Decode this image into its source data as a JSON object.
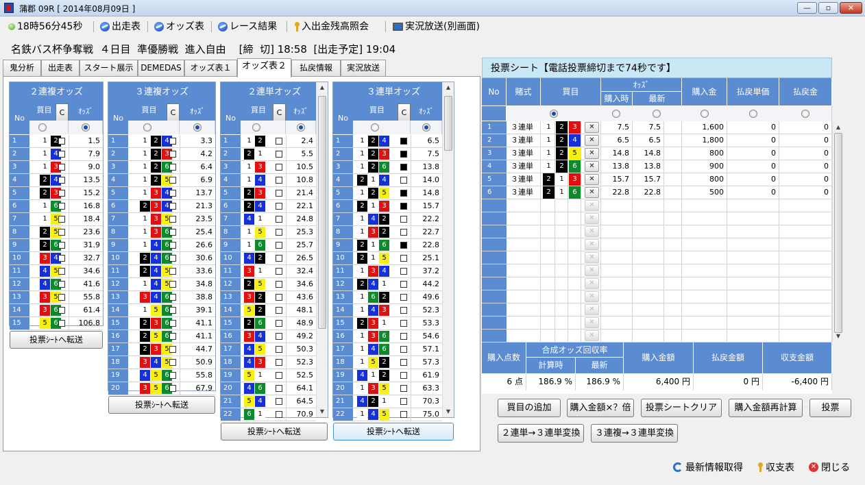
{
  "window": {
    "title": "蒲郡 09R [ 2014年08月09日 ]",
    "min": "—",
    "max": "▫",
    "close": "✕"
  },
  "toolbar": {
    "clock": "18時56分45秒",
    "entries": "出走表",
    "odds": "オッズ表",
    "results": "レース結果",
    "balance": "入出金残高照会",
    "live": "実況放送(別画面)"
  },
  "race": {
    "info": "名鉄バス杯争奪戦  ４日目  準優勝戦  進入自由    [締  切] 18:58  [出走予定] 19:04"
  },
  "tabs": [
    "鬼分析",
    "出走表",
    "スタート展示",
    "DEMEDAS",
    "オッズ表１",
    "オッズ表２",
    "払戻情報",
    "実況放送"
  ],
  "common": {
    "no": "No",
    "kaime": "買目",
    "odds_hdr": "ｵｯｽﾞ",
    "c": "C",
    "transfer": "投票ｼｰﾄへ転送"
  },
  "table1": {
    "title": "２連複オッズ",
    "rows": [
      {
        "no": "1",
        "b": [
          1,
          2
        ],
        "o": "1.5"
      },
      {
        "no": "2",
        "b": [
          1,
          4
        ],
        "o": "7.9"
      },
      {
        "no": "3",
        "b": [
          1,
          3
        ],
        "o": "9.0"
      },
      {
        "no": "4",
        "b": [
          2,
          4
        ],
        "o": "13.5"
      },
      {
        "no": "5",
        "b": [
          2,
          3
        ],
        "o": "15.2"
      },
      {
        "no": "6",
        "b": [
          1,
          6
        ],
        "o": "16.8"
      },
      {
        "no": "7",
        "b": [
          1,
          5
        ],
        "o": "18.4"
      },
      {
        "no": "8",
        "b": [
          2,
          5
        ],
        "o": "23.6"
      },
      {
        "no": "9",
        "b": [
          2,
          6
        ],
        "o": "31.9"
      },
      {
        "no": "10",
        "b": [
          3,
          4
        ],
        "o": "32.7"
      },
      {
        "no": "11",
        "b": [
          4,
          5
        ],
        "o": "34.6"
      },
      {
        "no": "12",
        "b": [
          4,
          6
        ],
        "o": "41.6"
      },
      {
        "no": "13",
        "b": [
          3,
          5
        ],
        "o": "55.8"
      },
      {
        "no": "14",
        "b": [
          3,
          6
        ],
        "o": "61.4"
      },
      {
        "no": "15",
        "b": [
          5,
          6
        ],
        "o": "106.8"
      }
    ]
  },
  "table2": {
    "title": "３連複オッズ",
    "rows": [
      {
        "no": "1",
        "b": [
          1,
          2,
          4
        ],
        "o": "3.3"
      },
      {
        "no": "2",
        "b": [
          1,
          2,
          3
        ],
        "o": "4.2"
      },
      {
        "no": "3",
        "b": [
          1,
          2,
          6
        ],
        "o": "6.4"
      },
      {
        "no": "4",
        "b": [
          1,
          2,
          5
        ],
        "o": "6.9"
      },
      {
        "no": "5",
        "b": [
          1,
          3,
          4
        ],
        "o": "13.7"
      },
      {
        "no": "6",
        "b": [
          2,
          3,
          4
        ],
        "o": "21.3"
      },
      {
        "no": "7",
        "b": [
          1,
          3,
          5
        ],
        "o": "23.5"
      },
      {
        "no": "8",
        "b": [
          1,
          3,
          6
        ],
        "o": "25.4"
      },
      {
        "no": "9",
        "b": [
          1,
          4,
          6
        ],
        "o": "26.6"
      },
      {
        "no": "10",
        "b": [
          2,
          4,
          6
        ],
        "o": "30.6"
      },
      {
        "no": "11",
        "b": [
          2,
          4,
          5
        ],
        "o": "33.6"
      },
      {
        "no": "12",
        "b": [
          1,
          4,
          5
        ],
        "o": "34.8"
      },
      {
        "no": "13",
        "b": [
          3,
          4,
          6
        ],
        "o": "38.8"
      },
      {
        "no": "14",
        "b": [
          1,
          5,
          6
        ],
        "o": "39.1"
      },
      {
        "no": "15",
        "b": [
          2,
          3,
          6
        ],
        "o": "41.1"
      },
      {
        "no": "16",
        "b": [
          2,
          5,
          6
        ],
        "o": "41.1"
      },
      {
        "no": "17",
        "b": [
          2,
          3,
          5
        ],
        "o": "44.7"
      },
      {
        "no": "18",
        "b": [
          3,
          4,
          5
        ],
        "o": "50.9"
      },
      {
        "no": "19",
        "b": [
          4,
          5,
          6
        ],
        "o": "55.8"
      },
      {
        "no": "20",
        "b": [
          3,
          5,
          6
        ],
        "o": "67.9"
      }
    ]
  },
  "table3": {
    "title": "２連単オッズ",
    "rows": [
      {
        "no": "1",
        "b": [
          1,
          2
        ],
        "o": "2.4"
      },
      {
        "no": "2",
        "b": [
          2,
          1
        ],
        "o": "5.5"
      },
      {
        "no": "3",
        "b": [
          1,
          3
        ],
        "o": "10.5"
      },
      {
        "no": "4",
        "b": [
          1,
          4
        ],
        "o": "10.8"
      },
      {
        "no": "5",
        "b": [
          2,
          3
        ],
        "o": "21.4"
      },
      {
        "no": "6",
        "b": [
          2,
          4
        ],
        "o": "22.1"
      },
      {
        "no": "7",
        "b": [
          4,
          1
        ],
        "o": "24.8"
      },
      {
        "no": "8",
        "b": [
          1,
          5
        ],
        "o": "25.3"
      },
      {
        "no": "9",
        "b": [
          1,
          6
        ],
        "o": "25.7"
      },
      {
        "no": "10",
        "b": [
          4,
          2
        ],
        "o": "26.5"
      },
      {
        "no": "11",
        "b": [
          3,
          1
        ],
        "o": "32.4"
      },
      {
        "no": "12",
        "b": [
          2,
          5
        ],
        "o": "34.6"
      },
      {
        "no": "13",
        "b": [
          3,
          2
        ],
        "o": "43.6"
      },
      {
        "no": "14",
        "b": [
          5,
          2
        ],
        "o": "48.1"
      },
      {
        "no": "15",
        "b": [
          2,
          6
        ],
        "o": "48.9"
      },
      {
        "no": "16",
        "b": [
          3,
          4
        ],
        "o": "49.2"
      },
      {
        "no": "17",
        "b": [
          4,
          5
        ],
        "o": "50.3"
      },
      {
        "no": "18",
        "b": [
          4,
          3
        ],
        "o": "52.3"
      },
      {
        "no": "19",
        "b": [
          5,
          1
        ],
        "o": "52.5"
      },
      {
        "no": "20",
        "b": [
          4,
          6
        ],
        "o": "64.1"
      },
      {
        "no": "21",
        "b": [
          5,
          4
        ],
        "o": "64.5"
      },
      {
        "no": "22",
        "b": [
          6,
          1
        ],
        "o": "70.9"
      }
    ]
  },
  "table4": {
    "title": "３連単オッズ",
    "rows": [
      {
        "no": "1",
        "b": [
          1,
          2,
          4
        ],
        "o": "6.5",
        "c": true
      },
      {
        "no": "2",
        "b": [
          1,
          2,
          3
        ],
        "o": "7.5",
        "c": true
      },
      {
        "no": "3",
        "b": [
          1,
          2,
          6
        ],
        "o": "13.8",
        "c": true
      },
      {
        "no": "4",
        "b": [
          2,
          1,
          4
        ],
        "o": "14.0",
        "c": false
      },
      {
        "no": "5",
        "b": [
          1,
          2,
          5
        ],
        "o": "14.8",
        "c": true
      },
      {
        "no": "6",
        "b": [
          2,
          1,
          3
        ],
        "o": "15.7",
        "c": true
      },
      {
        "no": "7",
        "b": [
          1,
          4,
          2
        ],
        "o": "22.2",
        "c": false
      },
      {
        "no": "8",
        "b": [
          1,
          3,
          2
        ],
        "o": "22.7",
        "c": false
      },
      {
        "no": "9",
        "b": [
          2,
          1,
          6
        ],
        "o": "22.8",
        "c": true
      },
      {
        "no": "10",
        "b": [
          2,
          1,
          5
        ],
        "o": "25.1",
        "c": false
      },
      {
        "no": "11",
        "b": [
          1,
          3,
          4
        ],
        "o": "37.2",
        "c": false
      },
      {
        "no": "12",
        "b": [
          2,
          4,
          1
        ],
        "o": "44.2",
        "c": false
      },
      {
        "no": "13",
        "b": [
          1,
          6,
          2
        ],
        "o": "49.6",
        "c": false
      },
      {
        "no": "14",
        "b": [
          1,
          4,
          3
        ],
        "o": "52.3",
        "c": false
      },
      {
        "no": "15",
        "b": [
          2,
          3,
          1
        ],
        "o": "53.3",
        "c": false
      },
      {
        "no": "16",
        "b": [
          1,
          3,
          6
        ],
        "o": "54.6",
        "c": false
      },
      {
        "no": "17",
        "b": [
          1,
          4,
          6
        ],
        "o": "57.1",
        "c": false
      },
      {
        "no": "18",
        "b": [
          1,
          5,
          2
        ],
        "o": "57.3",
        "c": false
      },
      {
        "no": "19",
        "b": [
          4,
          1,
          2
        ],
        "o": "61.9",
        "c": false
      },
      {
        "no": "20",
        "b": [
          1,
          3,
          5
        ],
        "o": "63.3",
        "c": false
      },
      {
        "no": "21",
        "b": [
          4,
          2,
          1
        ],
        "o": "70.3",
        "c": false
      },
      {
        "no": "22",
        "b": [
          1,
          4,
          5
        ],
        "o": "75.0",
        "c": false
      }
    ]
  },
  "sheet": {
    "title": "投票シート【電話投票締切まで74秒です】",
    "headers": {
      "no": "No",
      "type": "賭式",
      "kaime": "買目",
      "odds": "ｵｯｽﾞ",
      "odds_buy": "購入時",
      "odds_latest": "最新",
      "amount": "購入金",
      "payout_unit": "払戻単価",
      "payout": "払戻金"
    },
    "rows": [
      {
        "no": "1",
        "type": "３連単",
        "b": [
          1,
          2,
          3
        ],
        "ob": "7.5",
        "ol": "7.5",
        "amt": "1,600",
        "pu": "0",
        "po": "0"
      },
      {
        "no": "2",
        "type": "３連単",
        "b": [
          1,
          2,
          4
        ],
        "ob": "6.5",
        "ol": "6.5",
        "amt": "1,800",
        "pu": "0",
        "po": "0"
      },
      {
        "no": "3",
        "type": "３連単",
        "b": [
          1,
          2,
          5
        ],
        "ob": "14.8",
        "ol": "14.8",
        "amt": "800",
        "pu": "0",
        "po": "0"
      },
      {
        "no": "4",
        "type": "３連単",
        "b": [
          1,
          2,
          6
        ],
        "ob": "13.8",
        "ol": "13.8",
        "amt": "900",
        "pu": "0",
        "po": "0"
      },
      {
        "no": "5",
        "type": "３連単",
        "b": [
          2,
          1,
          3
        ],
        "ob": "15.7",
        "ol": "15.7",
        "amt": "800",
        "pu": "0",
        "po": "0"
      },
      {
        "no": "6",
        "type": "３連単",
        "b": [
          2,
          1,
          6
        ],
        "ob": "22.8",
        "ol": "22.8",
        "amt": "500",
        "pu": "0",
        "po": "0"
      }
    ],
    "empty_rows": 11,
    "summary": {
      "count_hdr": "購入点数",
      "synth_hdr": "合成オッズ回収率",
      "buy_hdr": "計算時",
      "latest_hdr": "最新",
      "total_hdr": "購入金額",
      "payout_hdr": "払戻金額",
      "balance_hdr": "収支金額",
      "count": "6 点",
      "synth_buy": "186.9 %",
      "synth_latest": "186.9 %",
      "total": "6,400 円",
      "payout": "0 円",
      "balance": "-6,400 円"
    }
  },
  "actions": {
    "add": "買目の追加",
    "multiply": "購入金額×？倍",
    "clear": "投票シートクリア",
    "recalc": "購入金額再計算",
    "vote": "投票",
    "conv1": "２連単→３連単変換",
    "conv2": "３連複→３連単変換"
  },
  "footer": {
    "refresh": "最新情報取得",
    "ledger": "収支表",
    "close": "閉じる"
  },
  "colors": {
    "header_blue": "#5b8bd0",
    "boat1": "#ffffff",
    "boat2": "#000000",
    "boat3": "#e01010",
    "boat4": "#1530d8",
    "boat5": "#f7f010",
    "boat6": "#0d8a2c"
  }
}
